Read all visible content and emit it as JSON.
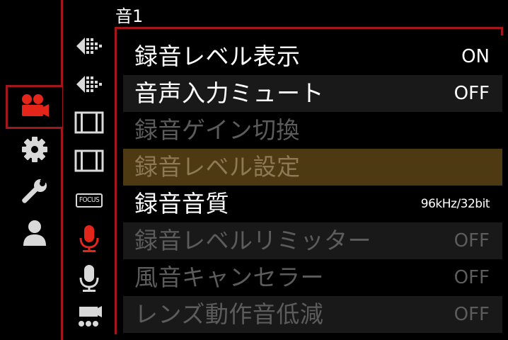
{
  "page": {
    "title": "音1"
  },
  "colors": {
    "accent_red": "#e4261a",
    "frame_red": "#a3161c",
    "selected_row": "#4e3a12",
    "disabled_text": "#5c5c5c",
    "active_text": "#ffffff"
  },
  "categories": [
    {
      "icon": "video-camera-icon",
      "active": true
    },
    {
      "icon": "gear-icon",
      "active": false
    },
    {
      "icon": "wrench-icon",
      "active": false
    },
    {
      "icon": "person-icon",
      "active": false
    }
  ],
  "sub_tabs": [
    {
      "icon": "dotted-arrow-left-icon"
    },
    {
      "icon": "dotted-arrow-left-icon"
    },
    {
      "icon": "film-strip-icon"
    },
    {
      "icon": "film-strip-icon"
    },
    {
      "icon": "focus-badge-icon",
      "label": "FOCUS"
    },
    {
      "icon": "microphone-icon",
      "active": true
    },
    {
      "icon": "microphone-icon",
      "active": false
    },
    {
      "icon": "camera-dots-icon"
    }
  ],
  "menu": {
    "items": [
      {
        "label": "録音レベル表示",
        "value": "ON",
        "state": "active"
      },
      {
        "label": "音声入力ミュート",
        "value": "OFF",
        "state": "active"
      },
      {
        "label": "録音ゲイン切換",
        "value": "",
        "state": "disabled"
      },
      {
        "label": "録音レベル設定",
        "value": "",
        "state": "selected"
      },
      {
        "label": "録音音質",
        "value": "96kHz/32bit",
        "state": "active"
      },
      {
        "label": "録音レベルリミッター",
        "value": "OFF",
        "state": "disabled"
      },
      {
        "label": "風音キャンセラー",
        "value": "OFF",
        "state": "disabled"
      },
      {
        "label": "レンズ動作音低減",
        "value": "OFF",
        "state": "disabled"
      }
    ]
  }
}
